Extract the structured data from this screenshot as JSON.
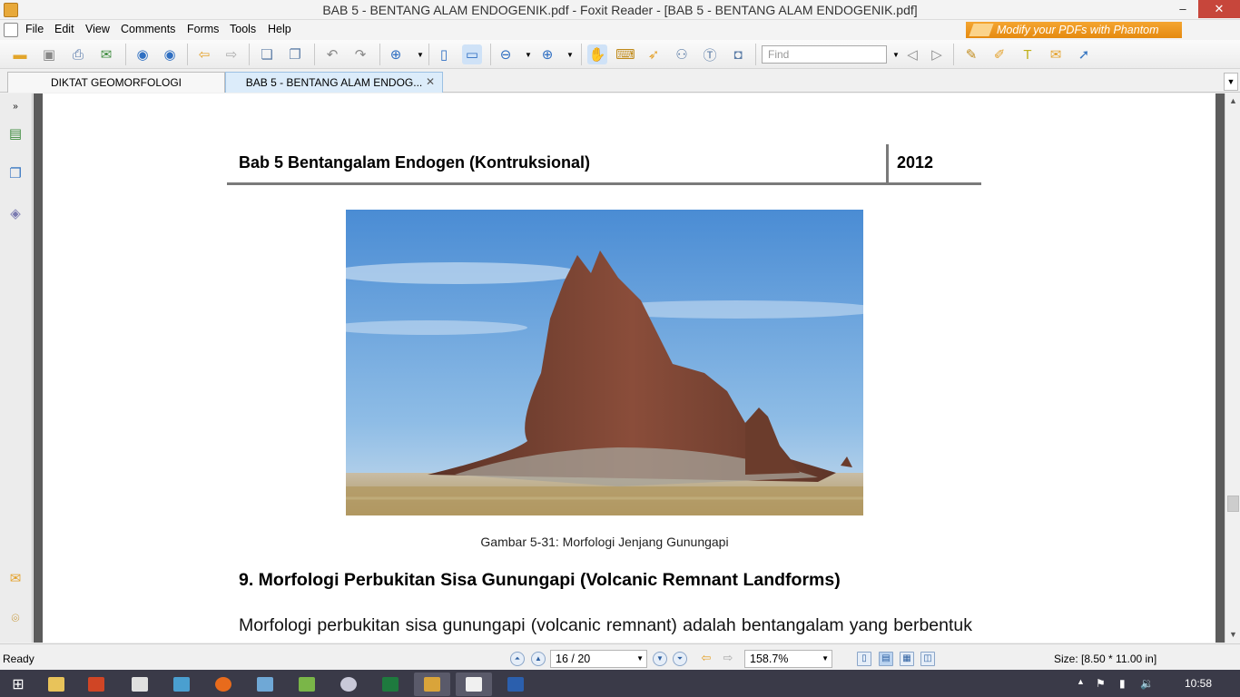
{
  "window": {
    "title": "BAB 5 - BENTANG ALAM ENDOGENIK.pdf - Foxit Reader - [BAB 5 - BENTANG ALAM ENDOGENIK.pdf]",
    "minimize_glyph": "–",
    "restore_glyph": "❐",
    "close_glyph": "✕"
  },
  "menu": {
    "items": [
      "File",
      "Edit",
      "View",
      "Comments",
      "Forms",
      "Tools",
      "Help"
    ]
  },
  "banner": {
    "text": "Modify your PDFs with Phantom"
  },
  "toolbar": {
    "find_placeholder": "Find",
    "icons": [
      "open-icon",
      "save-icon",
      "print-icon",
      "email-icon",
      "page-up-icon",
      "page-down-icon",
      "back-icon",
      "forward-icon",
      "extract-icon",
      "insert-icon",
      "undo-icon",
      "redo-icon",
      "zoom-in-icon",
      "page-fit-icon",
      "fit-width-icon",
      "zoom-out-icon",
      "zoom-plus-icon",
      "hand-icon",
      "snapshot-text-icon",
      "select-icon",
      "find-binoculars-icon",
      "text-select-icon",
      "camera-icon",
      "find-prev-icon",
      "find-next-icon",
      "pen-icon",
      "highlight-icon",
      "typewriter-icon",
      "note-icon",
      "arrow-icon"
    ]
  },
  "tabs": [
    {
      "label": "DIKTAT GEOMORFOLOGI"
    },
    {
      "label": "BAB 5 - BENTANG ALAM ENDOG...",
      "close": "✕"
    }
  ],
  "document": {
    "header_left": "Bab 5 Bentangalam Endogen (Kontruksional)",
    "header_right": "2012",
    "caption": "Gambar 5-31: Morfologi Jenjang Gunungapi",
    "heading": "9.  Morfologi Perbukitan Sisa Gunungapi (Volcanic Remnant Landforms)",
    "paragraph": "Morfologi perbukitan sisa gunungapi (volcanic remnant) adalah bentangalam yang berbentuk perbukitan/bukit yang merupakan sisa-sisa dari suatu gunungapi yang telah mengalami"
  },
  "status": {
    "ready": "Ready",
    "page": "16 / 20",
    "zoom": "158.7%",
    "size": "Size: [8.50 * 11.00 in]"
  },
  "taskbar": {
    "clock": "10:58",
    "apps": [
      "start",
      "file-explorer",
      "powerpoint",
      "pdf-tool",
      "network-tool",
      "firefox",
      "keyboard",
      "green-app",
      "paint-app",
      "excel",
      "xmind",
      "foxit-reader",
      "word"
    ]
  },
  "colors": {
    "banner": "#e58a10",
    "taskbar": "#3a3a48",
    "active_tab": "#dcecfa",
    "viewer_bg": "#5c5c5c"
  }
}
